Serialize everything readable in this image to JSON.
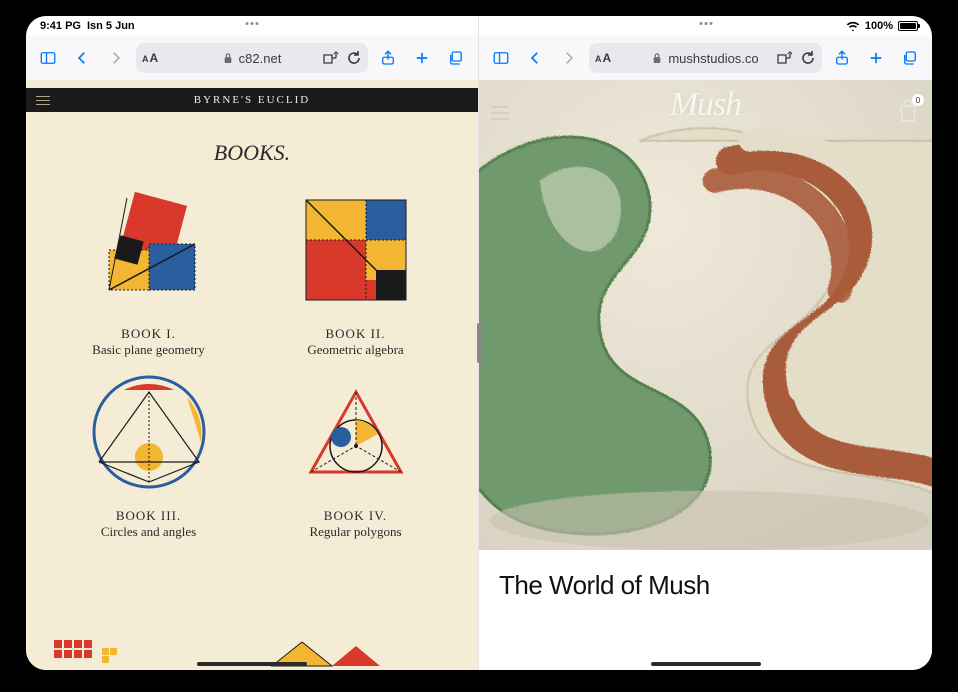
{
  "status": {
    "time": "9:41 PG",
    "date": "Isn 5 Jun",
    "battery_pct": "100%"
  },
  "left_pane": {
    "url_text": "c82.net",
    "page_header": "BYRNE'S EUCLID",
    "section_title": "BOOKS.",
    "books": [
      {
        "num": "BOOK I.",
        "sub": "Basic plane geometry"
      },
      {
        "num": "BOOK II.",
        "sub": "Geometric algebra"
      },
      {
        "num": "BOOK III.",
        "sub": "Circles and angles"
      },
      {
        "num": "BOOK IV.",
        "sub": "Regular polygons"
      }
    ]
  },
  "right_pane": {
    "url_text": "mushstudios.co",
    "logo_text": "Mush",
    "cart_count": "0",
    "headline": "The World of Mush"
  },
  "colors": {
    "ios_blue": "#007aff",
    "euclid_bg": "#f5ecd6",
    "byrne_red": "#d8392b",
    "byrne_blue": "#2b5e9e",
    "byrne_yellow": "#f2b632",
    "byrne_black": "#1a1a1a",
    "mush_green": "#6f9a6e",
    "mush_cream": "#e6e0ce",
    "mush_rust": "#a85b3a"
  }
}
